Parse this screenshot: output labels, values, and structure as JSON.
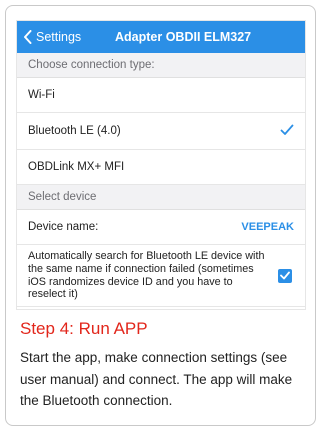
{
  "nav": {
    "back_label": "Settings",
    "title": "Adapter OBDII ELM327"
  },
  "connection": {
    "header": "Choose connection type:",
    "options": [
      {
        "label": "Wi-Fi",
        "selected": false
      },
      {
        "label": "Bluetooth LE (4.0)",
        "selected": true
      },
      {
        "label": "OBDLink MX+ MFI",
        "selected": false
      }
    ]
  },
  "device": {
    "header": "Select device",
    "name_label": "Device name:",
    "name_value": "VEEPEAK",
    "auto_search_text": "Automatically search for Bluetooth LE device with the same name if connection failed (sometimes iOS randomizes device ID and you have to reselect it)",
    "auto_search_checked": true
  },
  "instructions": {
    "step_title": "Step 4: Run APP",
    "body": "Start the app, make connection settings (see user manual) and connect. The app will make the Bluetooth connection."
  },
  "colors": {
    "accent": "#2b8fe6",
    "step_title": "#e2261b"
  }
}
